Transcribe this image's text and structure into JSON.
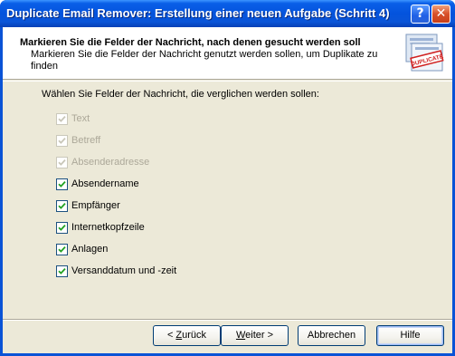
{
  "window": {
    "title": "Duplicate Email Remover: Erstellung einer neuen Aufgabe (Schritt 4)",
    "help_glyph": "?",
    "close_glyph": "✕"
  },
  "header": {
    "title": "Markieren Sie die Felder der Nachricht, nach denen gesucht werden soll",
    "description": "Markieren Sie die Felder der Nachricht genutzt werden sollen, um Duplikate zu finden",
    "icon_label": "DUPLICATE",
    "icon": "duplicate-stamp-icon"
  },
  "body": {
    "prompt": "Wählen Sie Felder der Nachricht, die verglichen werden sollen:",
    "fields": [
      {
        "label": "Text",
        "checked": true,
        "enabled": false
      },
      {
        "label": "Betreff",
        "checked": true,
        "enabled": false
      },
      {
        "label": "Absenderadresse",
        "checked": true,
        "enabled": false
      },
      {
        "label": "Absendername",
        "checked": true,
        "enabled": true
      },
      {
        "label": "Empfänger",
        "checked": true,
        "enabled": true
      },
      {
        "label": "Internetkopfzeile",
        "checked": true,
        "enabled": true
      },
      {
        "label": "Anlagen",
        "checked": true,
        "enabled": true
      },
      {
        "label": "Versanddatum und -zeit",
        "checked": true,
        "enabled": true
      }
    ]
  },
  "buttons": {
    "back_prefix": "< ",
    "back_mnemonic": "Z",
    "back_rest": "urück",
    "next_mnemonic": "W",
    "next_rest": "eiter >",
    "cancel": "Abbrechen",
    "help": "Hilfe"
  },
  "colors": {
    "titlebar": "#0453dd",
    "face": "#ece9d8",
    "check": "#21a121"
  }
}
